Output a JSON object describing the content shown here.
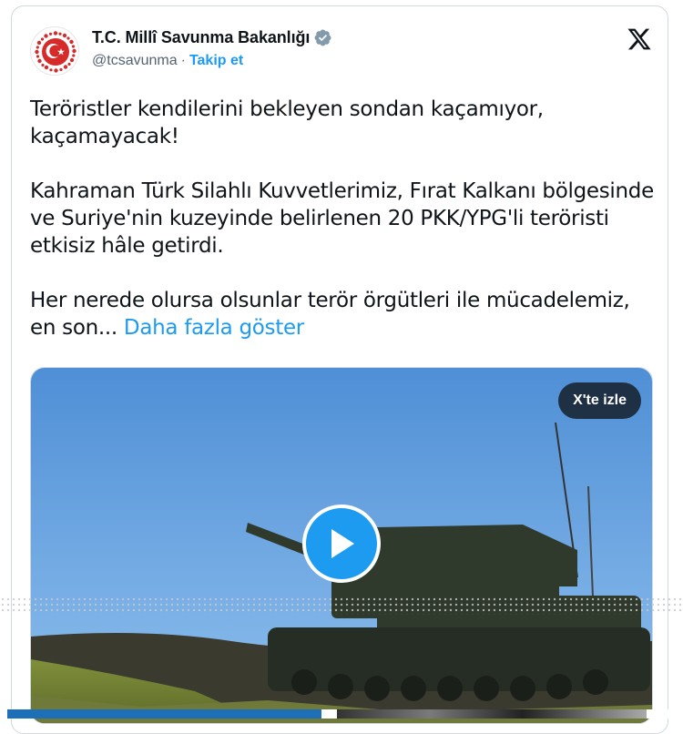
{
  "account": {
    "display_name": "T.C. Millî Savunma Bakanlığı",
    "handle": "@tcsavunma",
    "separator": "·",
    "follow_label": "Takip et",
    "verified": true,
    "verified_color": "#829aab"
  },
  "platform_icon": "x-logo-icon",
  "tweet": {
    "paragraphs": [
      "Teröristler kendilerini bekleyen sondan kaçamıyor, kaçamayacak!",
      "Kahraman Türk Silahlı Kuvvetlerimiz, Fırat Kalkanı bölgesinde ve Suriye'nin kuzeyinde belirlenen 20 PKK/YPG'li teröristi etkisiz hâle getirdi."
    ],
    "last_paragraph": "Her nerede olursa olsunlar terör örgütleri ile mücadelemiz, en son...",
    "show_more_label": "Daha fazla göster"
  },
  "media": {
    "type": "video",
    "watch_label": "X'te izle",
    "play_icon": "play-icon"
  },
  "colors": {
    "accent": "#1d9bf0",
    "text": "#0f1419",
    "secondary_text": "#536471",
    "border": "#cfd9de"
  }
}
